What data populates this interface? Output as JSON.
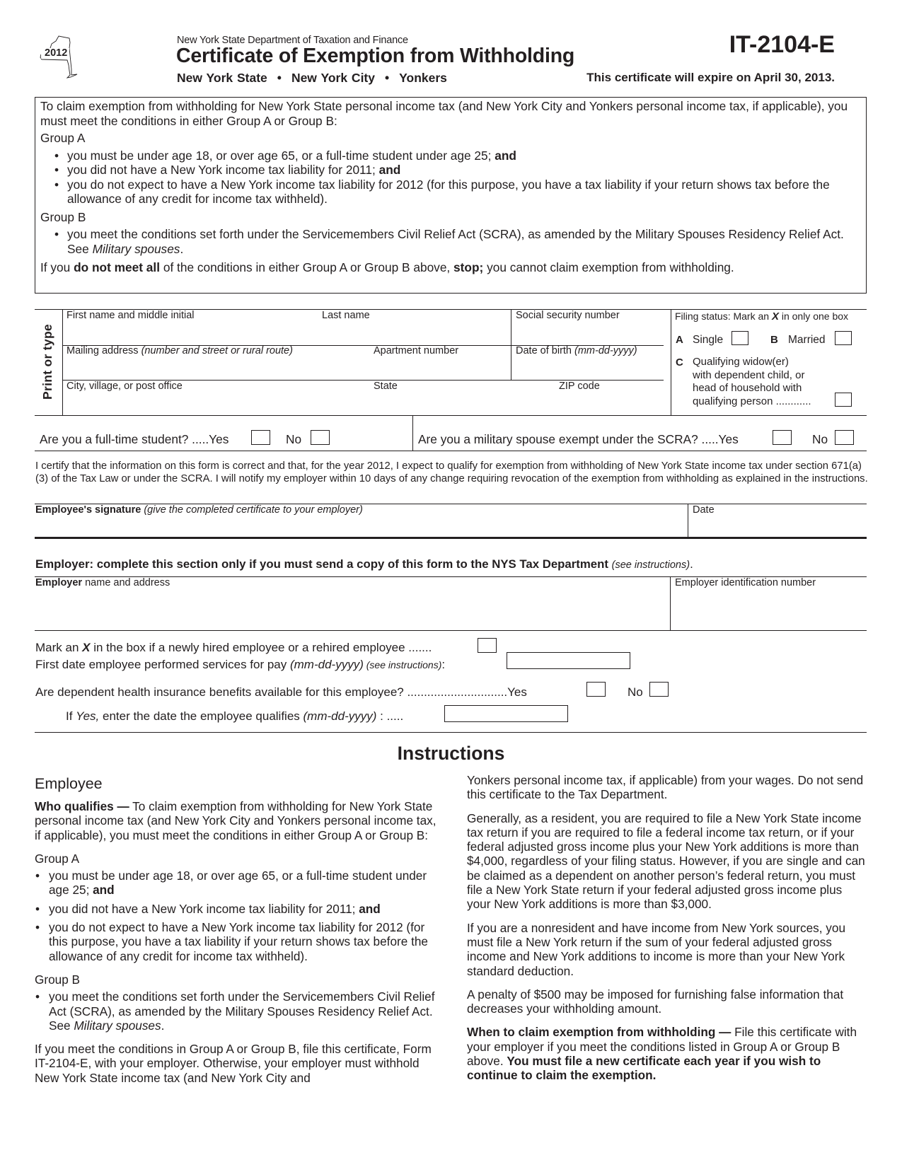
{
  "header": {
    "tax_year_badge": "2012",
    "department": "New York State Department of Taxation and Finance",
    "title": "Certificate of Exemption from Withholding",
    "jurisdictions": [
      "New York State",
      "New York City",
      "Yonkers"
    ],
    "separator": "•",
    "form_number": "IT-2104-E",
    "expiration_notice": "This certificate will expire on April 30, 2013."
  },
  "claim_box": {
    "intro": "To claim exemption from withholding for New York State personal income tax (and New York City and Yonkers personal income tax, if applicable), you must meet the conditions in either Group A or Group B:",
    "group_a_label": "Group A",
    "group_a_items": [
      {
        "text": "you must be under age 18, or over age 65, or a full-time student under age 25; ",
        "bold": "and"
      },
      {
        "text": "you did not have a New York income tax liability for 2011; ",
        "bold": "and"
      },
      {
        "text": "you do not expect to have a New York income tax liability for 2012 (for this purpose, you have a tax liability if your return shows tax before the allowance of any credit for income tax withheld).",
        "bold": ""
      }
    ],
    "group_b_label": "Group B",
    "group_b_item": {
      "text": "you meet the conditions set forth under the Servicemembers Civil Relief Act (SCRA), as amended by the Military Spouses Residency Relief Act. See ",
      "italic": "Military spouses",
      "end": "."
    },
    "stop_line": {
      "pre": "If you ",
      "bold1": "do not meet all",
      "mid": " of the conditions in either Group A or Group B above, ",
      "bold2": "stop;",
      "post": " you cannot claim exemption from withholding."
    }
  },
  "employee_section": {
    "side_label": "Print or type",
    "first_name_label": "First name and middle initial",
    "last_name_label": "Last name",
    "ssn_label": "Social security number",
    "mailing_address_label": "Mailing address ",
    "mailing_address_hint": "(number and street or rural route)",
    "apartment_label": "Apartment number",
    "dob_label": "Date of birth ",
    "dob_hint": "(mm-dd-yyyy)",
    "city_label": "City, village, or post office",
    "state_label": "State",
    "zip_label": "ZIP code",
    "filing_status": {
      "heading_pre": "Filing status: Mark an ",
      "heading_x": "X",
      "heading_post": " in only one box",
      "options": [
        {
          "letter": "A",
          "label": "Single"
        },
        {
          "letter": "B",
          "label": "Married"
        },
        {
          "letter": "C",
          "label_lines": [
            "Qualifying widow(er)",
            "with dependent child, or",
            "head of household with",
            "qualifying person ............"
          ]
        }
      ]
    },
    "student_question": "Are you a full-time student? .....",
    "military_question": "Are you a military spouse exempt under the SCRA? .....",
    "yes_label": "Yes",
    "no_label": "No"
  },
  "certification": {
    "text": "I certify that the information on this form is correct and that, for the year 2012, I expect to qualify for exemption from withholding of New York State income tax under section 671(a)(3) of the Tax Law or under the SCRA. I will notify my employer within 10 days of any change requiring revocation of the exemption from withholding as explained in the instructions.",
    "signature_label_bold": "Employee's signature",
    "signature_label_hint": " (give the completed certificate to your employer)",
    "date_label": "Date"
  },
  "employer_section": {
    "heading_bold": "Employer: complete this section only if you must send a copy of this form to the NYS Tax Department ",
    "heading_hint": "(see instructions)",
    "heading_end": ".",
    "name_label_bold": "Employer",
    "name_label_rest": " name and address",
    "ein_label": "Employer identification number",
    "new_hire_pre": "Mark an ",
    "new_hire_x": "X",
    "new_hire_post": " in the box if a newly hired employee or a rehired employee .......",
    "first_date_pre": "First date employee performed services for pay ",
    "first_date_hint": "(mm-dd-yyyy)",
    "first_date_see": " (see instructions)",
    "first_date_end": ":",
    "health_question": "Are dependent health insurance benefits available for this employee? ..............................",
    "yes_label": "Yes",
    "no_label": "No",
    "qualify_pre": "If ",
    "qualify_yes": "Yes,",
    "qualify_mid": " enter the date the employee qualifies ",
    "qualify_hint": "(mm-dd-yyyy)",
    "qualify_end": " : ....."
  },
  "instructions": {
    "title": "Instructions",
    "left": {
      "heading": "Employee",
      "who_qualifies_bold": "Who qualifies —",
      "who_qualifies_text": " To claim exemption from withholding for New York State personal income tax (and New York City and Yonkers personal income tax, if applicable), you must meet the conditions in either Group A or Group B:",
      "group_a_label": "Group A",
      "group_a_items": [
        {
          "text": "you must be under age 18, or over age 65, or a full-time student under age 25; ",
          "bold": "and"
        },
        {
          "text": "you did not have a New York income tax liability for 2011; ",
          "bold": "and"
        },
        {
          "text": "you do not expect to have a New York income tax liability for 2012 (for this purpose, you have a tax liability if your return shows tax before the allowance of any credit for income tax withheld).",
          "bold": ""
        }
      ],
      "group_b_label": "Group B",
      "group_b_item": {
        "text": "you meet the conditions set forth under the Servicemembers Civil Relief Act (SCRA), as amended by the Military Spouses Residency Relief Act. See ",
        "italic": "Military spouses",
        "end": "."
      },
      "file_paragraph": "If you meet the conditions in Group A or Group B, file this certificate, Form IT-2104-E, with your employer. Otherwise, your employer must withhold New York State income tax (and New York City and"
    },
    "right": {
      "continued": "Yonkers personal income tax, if applicable) from your wages. Do not send this certificate to the Tax Department.",
      "resident": "Generally, as a resident, you are required to file a New York State income tax return if you are required to file a federal income tax return, or if your federal adjusted gross income plus your New York additions is more than $4,000, regardless of your filing status. However, if you are single and can be claimed as a dependent on another person’s federal return, you must file a New York State return if your federal adjusted gross income plus your New York additions is more than $3,000.",
      "nonresident": "If you are a nonresident and have income from New York sources, you must file a New York return if the sum of your federal adjusted gross income and New York additions to income is more than your New York standard deduction.",
      "penalty": "A penalty of $500 may be imposed for furnishing false information that decreases your withholding amount.",
      "when_bold": "When to claim exemption from withholding —",
      "when_text": " File this certificate with your employer if you meet the conditions listed in Group A or Group B above. ",
      "when_bold_end": "You must file a new certificate each year if you wish to continue to claim the exemption."
    }
  }
}
